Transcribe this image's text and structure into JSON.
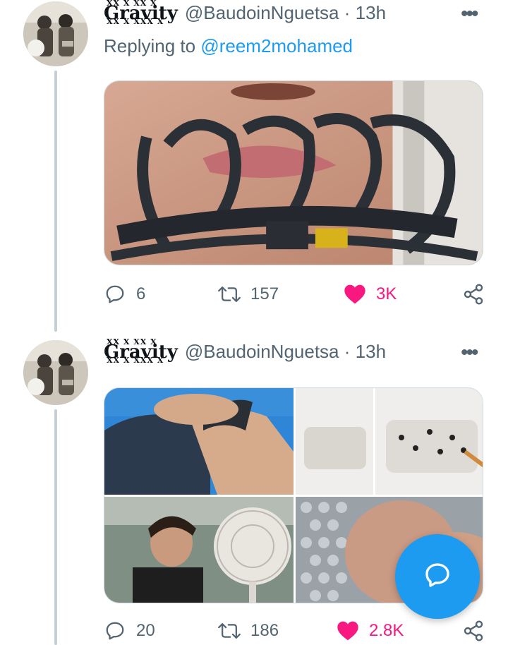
{
  "tweets": [
    {
      "display_name": "Gravity",
      "name_marks_top": "XX X XX X",
      "name_marks_bottom": "XX X XXX X",
      "handle": "@BaudoinNguetsa",
      "separator": "·",
      "time": "13h",
      "reply_prefix": "Replying to",
      "reply_mention": "@reem2mohamed",
      "replies": "6",
      "retweets": "157",
      "likes": "3K",
      "liked": true
    },
    {
      "display_name": "Gravity",
      "name_marks_top": "XX X XX X",
      "name_marks_bottom": "XX X XXX X",
      "handle": "@BaudoinNguetsa",
      "separator": "·",
      "time": "13h",
      "replies": "20",
      "retweets": "186",
      "likes": "2.8K",
      "liked": true
    }
  ],
  "icons": {
    "reply": "reply-icon",
    "retweet": "retweet-icon",
    "like": "heart-icon",
    "share": "share-icon",
    "more": "more-icon",
    "compose": "compose-reply-icon"
  },
  "colors": {
    "accent": "#1d9bf0",
    "like": "#f91880",
    "muted": "#536471",
    "thread_line": "#c4cfd6"
  }
}
